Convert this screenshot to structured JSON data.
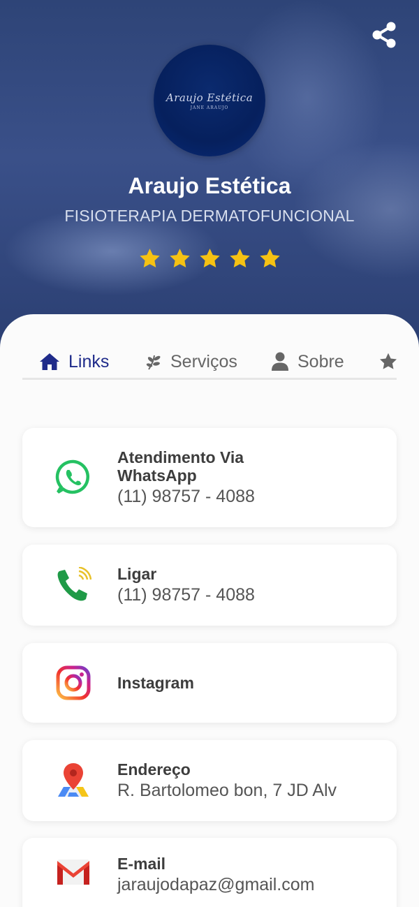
{
  "header": {
    "business_name": "Araujo Estética",
    "subtitle": "FISIOTERAPIA DERMATOFUNCIONAL",
    "logo_text": "Araujo Estética",
    "logo_sub": "JANE ARAUJO",
    "rating": 5,
    "rating_max": 5
  },
  "tabs": [
    {
      "label": "Links",
      "icon": "home-icon",
      "active": true
    },
    {
      "label": "Serviços",
      "icon": "leaf-icon",
      "active": false
    },
    {
      "label": "Sobre",
      "icon": "user-icon",
      "active": false
    },
    {
      "label": "",
      "icon": "star-icon",
      "active": false
    }
  ],
  "links": [
    {
      "title": "Atendimento Via WhatsApp",
      "value": "(11) 98757 - 4088",
      "icon": "whatsapp-icon"
    },
    {
      "title": "Ligar",
      "value": "(11) 98757 - 4088",
      "icon": "phone-icon"
    },
    {
      "title": "Instagram",
      "value": "",
      "icon": "instagram-icon"
    },
    {
      "title": "Endereço",
      "value": "R. Bartolomeo bon, 7 JD Alv",
      "icon": "map-pin-icon"
    },
    {
      "title": "E-mail",
      "value": "jaraujodapaz@gmail.com",
      "icon": "gmail-icon"
    }
  ],
  "colors": {
    "accent": "#1f2b8a",
    "star": "#f6c213",
    "whatsapp": "#25c162",
    "phone": "#1f9a47"
  }
}
